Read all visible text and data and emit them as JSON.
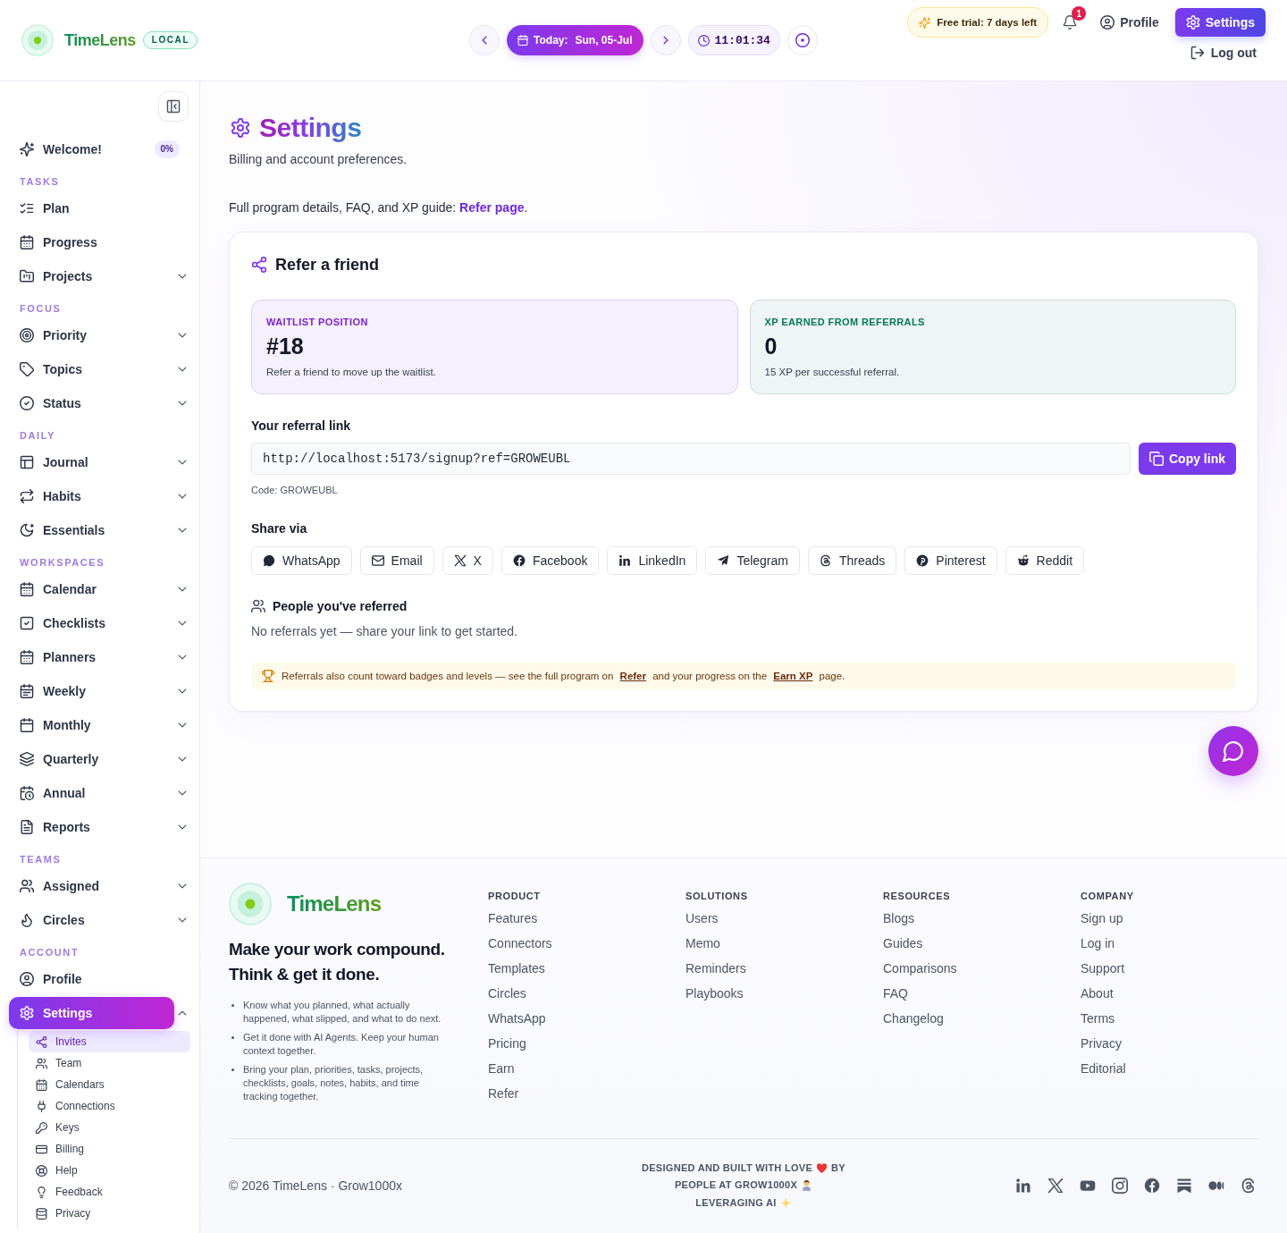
{
  "header": {
    "brand": {
      "name": "TimeLens",
      "badge": "LOCAL"
    },
    "date_nav": {
      "date_label": "Today:",
      "date": "Sun, 05-Jul",
      "time": "11:01:34"
    },
    "trial": "Free trial: 7 days left",
    "notifications": {
      "count": "1"
    },
    "nav": [
      {
        "label": "Profile",
        "selected": false
      },
      {
        "label": "Settings",
        "selected": true
      }
    ],
    "logout": "Log out"
  },
  "sidebar": {
    "welcome": {
      "label": "Welcome!",
      "badge": "0%",
      "selected": false
    },
    "sections": [
      {
        "title": "TASKS",
        "items": [
          {
            "label": "Plan",
            "selected": false
          },
          {
            "label": "Progress",
            "selected": false
          },
          {
            "label": "Projects",
            "selected": false,
            "expanded": false
          }
        ]
      },
      {
        "title": "FOCUS",
        "items": [
          {
            "label": "Priority",
            "selected": false,
            "expanded": false
          },
          {
            "label": "Topics",
            "selected": false,
            "expanded": false
          },
          {
            "label": "Status",
            "selected": false,
            "expanded": false
          }
        ]
      },
      {
        "title": "DAILY",
        "items": [
          {
            "label": "Journal",
            "selected": false,
            "expanded": false
          },
          {
            "label": "Habits",
            "selected": false,
            "expanded": false
          },
          {
            "label": "Essentials",
            "selected": false,
            "expanded": false
          }
        ]
      },
      {
        "title": "WORKSPACES",
        "items": [
          {
            "label": "Calendar",
            "selected": false,
            "expanded": false
          },
          {
            "label": "Checklists",
            "selected": false,
            "expanded": false
          },
          {
            "label": "Planners",
            "selected": false,
            "expanded": false
          },
          {
            "label": "Weekly",
            "selected": false,
            "expanded": false
          },
          {
            "label": "Monthly",
            "selected": false,
            "expanded": false
          },
          {
            "label": "Quarterly",
            "selected": false,
            "expanded": false
          },
          {
            "label": "Annual",
            "selected": false,
            "expanded": false
          },
          {
            "label": "Reports",
            "selected": false,
            "expanded": false
          }
        ]
      },
      {
        "title": "TEAMS",
        "items": [
          {
            "label": "Assigned",
            "selected": false,
            "expanded": false
          },
          {
            "label": "Circles",
            "selected": false,
            "expanded": false
          }
        ]
      },
      {
        "title": "ACCOUNT",
        "items": [
          {
            "label": "Profile",
            "selected": false
          },
          {
            "label": "Settings",
            "selected": true,
            "expanded": true,
            "children": [
              {
                "label": "Invites",
                "selected": true
              },
              {
                "label": "Team",
                "selected": false
              },
              {
                "label": "Calendars",
                "selected": false
              },
              {
                "label": "Connections",
                "selected": false
              },
              {
                "label": "Keys",
                "selected": false
              },
              {
                "label": "Billing",
                "selected": false
              },
              {
                "label": "Help",
                "selected": false
              },
              {
                "label": "Feedback",
                "selected": false
              },
              {
                "label": "Privacy",
                "selected": false
              }
            ]
          }
        ]
      }
    ]
  },
  "page": {
    "title": "Settings",
    "subtitle": "Billing and account preferences.",
    "intro": [
      {
        "kind": "text",
        "text": "Full program details, FAQ, and XP guide: "
      },
      {
        "kind": "link",
        "text": "Refer page"
      },
      {
        "kind": "text",
        "text": "."
      }
    ]
  },
  "referral": {
    "title": "Refer a friend",
    "stats": [
      {
        "label": "WAITLIST POSITION",
        "value": "#18",
        "note": "Refer a friend to move up the waitlist.",
        "color": "#7e22ce"
      },
      {
        "label": "XP EARNED FROM REFERRALS",
        "value": "0",
        "note": "15 XP per successful referral.",
        "color": "#047857"
      }
    ],
    "link_label": "Your referral link",
    "link_value": "http://localhost:5173/signup?ref=GROWEUBL",
    "copy_button": "Copy link",
    "code": "Code: GROWEUBL",
    "share_title": "Share via",
    "share_options": [
      "WhatsApp",
      "Email",
      "X",
      "Facebook",
      "LinkedIn",
      "Telegram",
      "Threads",
      "Pinterest",
      "Reddit"
    ],
    "referred_title": "People you've referred",
    "referred_empty": "No referrals yet — share your link to get started.",
    "notice": [
      {
        "kind": "text",
        "text": "Referrals also count toward badges and levels — see the full program on "
      },
      {
        "kind": "link",
        "text": "Refer"
      },
      {
        "kind": "text",
        "text": " and your progress on the "
      },
      {
        "kind": "link",
        "text": "Earn XP"
      },
      {
        "kind": "text",
        "text": " page."
      }
    ]
  },
  "footer": {
    "brand": "TimeLens",
    "tagline": [
      "Make your work compound.",
      "Think & get it done."
    ],
    "bullets": [
      "Know what you planned, what actually happened, what slipped, and what to do next.",
      "Get it done with AI Agents. Keep your human context together.",
      "Bring your plan, priorities, tasks, projects, checklists, goals, notes, habits, and time tracking together."
    ],
    "columns": [
      {
        "heading": "PRODUCT",
        "links": [
          "Features",
          "Connectors",
          "Templates",
          "Circles",
          "WhatsApp",
          "Pricing",
          "Earn",
          "Refer"
        ]
      },
      {
        "heading": "SOLUTIONS",
        "links": [
          "Users",
          "Memo",
          "Reminders",
          "Playbooks"
        ]
      },
      {
        "heading": "RESOURCES",
        "links": [
          "Blogs",
          "Guides",
          "Comparisons",
          "FAQ",
          "Changelog"
        ]
      },
      {
        "heading": "COMPANY",
        "links": [
          "Sign up",
          "Log in",
          "Support",
          "About",
          "Terms",
          "Privacy",
          "Editorial"
        ]
      }
    ],
    "copyright": "© 2026 TimeLens · Grow1000x",
    "credits": [
      {
        "text": "DESIGNED AND BUILT WITH LOVE",
        "after_icon": "BY"
      },
      {
        "text": "PEOPLE AT GROW1000X"
      },
      {
        "text": "LEVERAGING AI"
      }
    ]
  }
}
